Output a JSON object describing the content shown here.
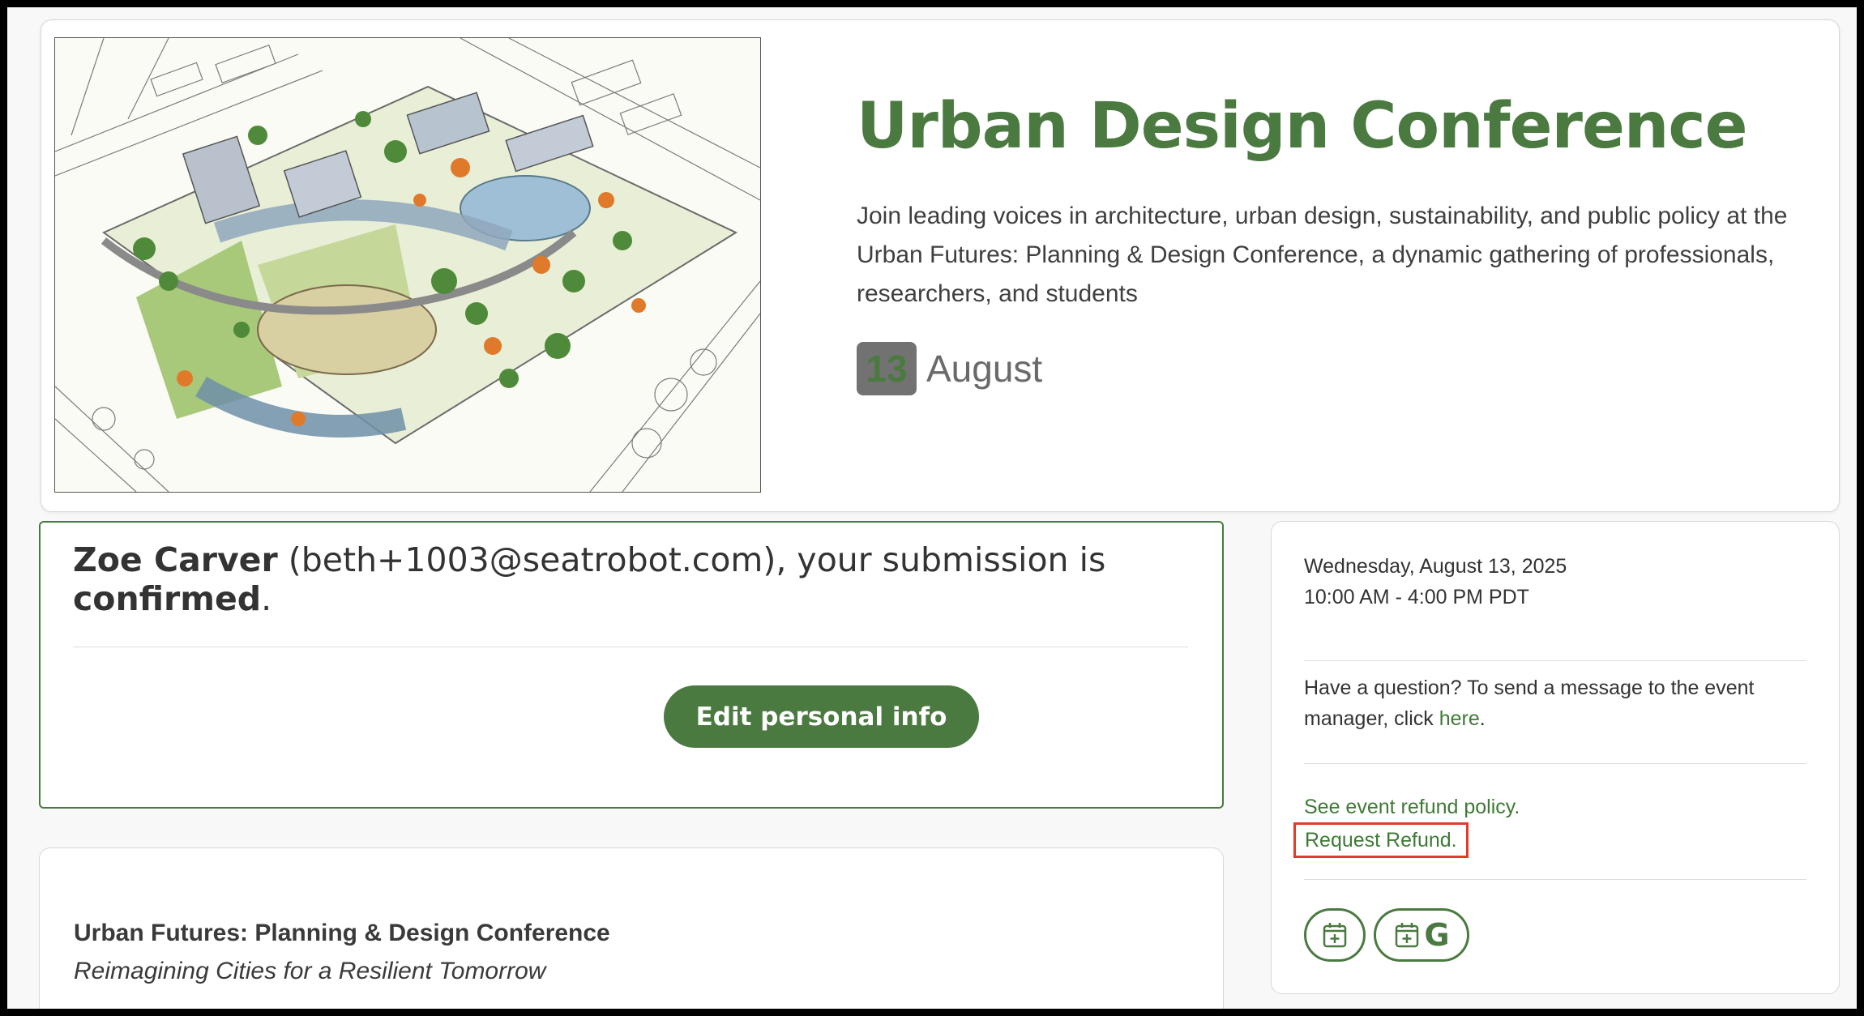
{
  "hero": {
    "title": "Urban Design Conference",
    "description": "Join leading voices in architecture, urban design, sustainability, and public policy at the Urban Futures: Planning & Design Conference, a dynamic gathering of professionals, researchers, and students",
    "day": "13",
    "month": "August"
  },
  "confirmation": {
    "name": "Zoe Carver",
    "email_part": " (beth+1003@seatrobot.com), your submission is ",
    "status": "confirmed",
    "period": ".",
    "edit_label": "Edit personal info"
  },
  "details": {
    "title": "Urban Futures: Planning & Design Conference",
    "subtitle": "Reimagining Cities for a Resilient Tomorrow"
  },
  "sidebar": {
    "date": "Wednesday, August 13, 2025",
    "time": "10:00 AM - 4:00 PM PDT",
    "question_text": "Have a question? To send a message to the event manager, click ",
    "question_link": "here",
    "question_period": ".",
    "refund_policy": "See event refund policy.",
    "request_refund": "Request Refund.",
    "cal_icon": "calendar-plus-icon",
    "gcal_icon": "google-calendar-icon"
  },
  "colors": {
    "brand_green": "#4a7a40",
    "link_green": "#3f7a36",
    "highlight_red": "#e03b2b",
    "badge_gray": "#727272"
  }
}
